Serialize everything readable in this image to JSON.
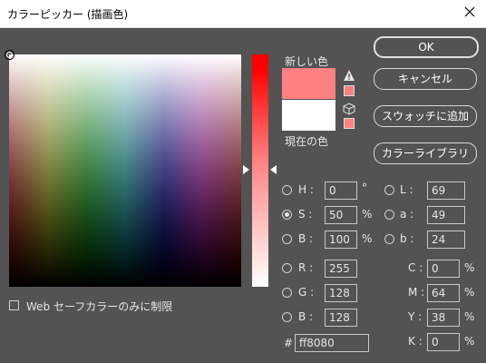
{
  "window": {
    "title": "カラーピッカー (描画色)"
  },
  "labels": {
    "new_color": "新しい色",
    "current_color": "現在の色"
  },
  "buttons": {
    "ok": "OK",
    "cancel": "キャンセル",
    "add_to_swatches": "スウォッチに追加",
    "color_libraries": "カラーライブラリ"
  },
  "web_safe_label": "Web セーフカラーのみに制限",
  "hsb": {
    "h": {
      "label": "H :",
      "value": "0",
      "unit": "°"
    },
    "s": {
      "label": "S :",
      "value": "50",
      "unit": "%"
    },
    "b": {
      "label": "B :",
      "value": "100",
      "unit": "%"
    }
  },
  "rgb": {
    "r": {
      "label": "R :",
      "value": "255"
    },
    "g": {
      "label": "G :",
      "value": "128"
    },
    "b": {
      "label": "B :",
      "value": "128"
    }
  },
  "lab": {
    "l": {
      "label": "L :",
      "value": "69"
    },
    "a": {
      "label": "a :",
      "value": "49"
    },
    "b": {
      "label": "b :",
      "value": "24"
    }
  },
  "cmyk": {
    "c": {
      "label": "C :",
      "value": "0",
      "unit": "%"
    },
    "m": {
      "label": "M :",
      "value": "64",
      "unit": "%"
    },
    "y": {
      "label": "Y :",
      "value": "38",
      "unit": "%"
    },
    "k": {
      "label": "K :",
      "value": "0",
      "unit": "%"
    }
  },
  "hex": {
    "label": "#",
    "value": "ff8080"
  },
  "colors": {
    "new": "#ff8080",
    "current": "#ffffff",
    "gamut_alert": "#ff8080"
  },
  "icons": {
    "close": "close-icon",
    "warning": "warning-icon",
    "cube": "cube-icon"
  }
}
